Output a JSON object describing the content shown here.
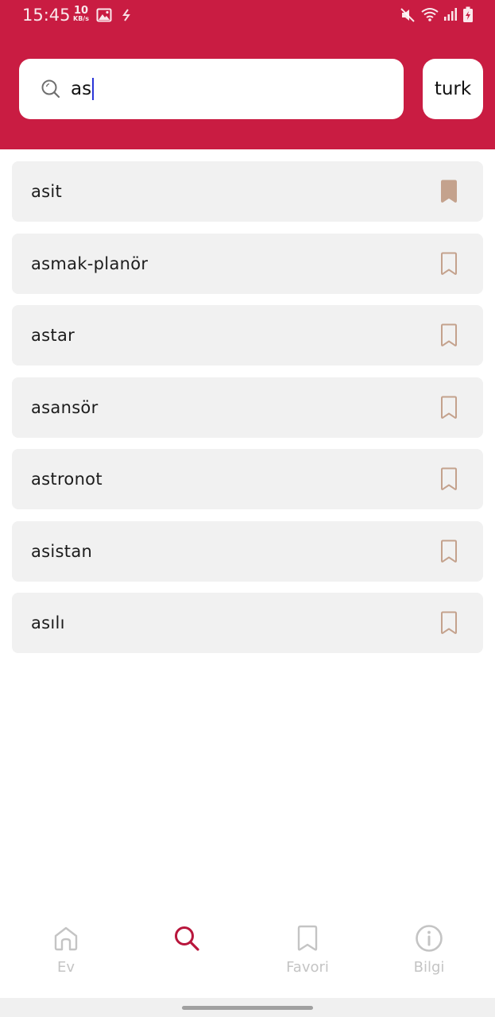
{
  "status_bar": {
    "time": "15:45",
    "net_speed_value": "10",
    "net_speed_unit": "KB/s",
    "icons": [
      "image-icon",
      "sync-icon",
      "mute-icon",
      "wifi-icon",
      "signal-icon",
      "battery-charging-icon"
    ]
  },
  "search": {
    "query": "as",
    "icon": "search-icon"
  },
  "language_button": {
    "label": "turk"
  },
  "results": [
    {
      "word": "asit",
      "bookmarked": true
    },
    {
      "word": "asmak-planör",
      "bookmarked": false
    },
    {
      "word": "astar",
      "bookmarked": false
    },
    {
      "word": "asansör",
      "bookmarked": false
    },
    {
      "word": "astronot",
      "bookmarked": false
    },
    {
      "word": "asistan",
      "bookmarked": false
    },
    {
      "word": "asılı",
      "bookmarked": false
    }
  ],
  "bottom_nav": {
    "items": [
      {
        "label": "Ev",
        "icon": "home-icon",
        "active": false
      },
      {
        "label": "",
        "icon": "search-icon",
        "active": true
      },
      {
        "label": "Favori",
        "icon": "bookmark-icon",
        "active": false
      },
      {
        "label": "Bilgi",
        "icon": "info-icon",
        "active": false
      }
    ]
  },
  "colors": {
    "header": "#c91c42",
    "bookmark": "#c4a28d",
    "nav_active": "#b8163c",
    "nav_inactive": "#c4c4c4",
    "item_bg": "#f1f1f1"
  }
}
